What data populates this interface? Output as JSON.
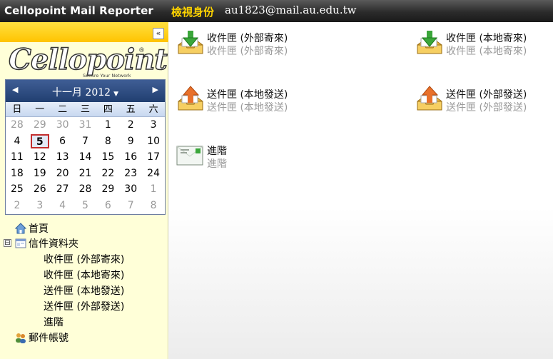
{
  "header": {
    "app_title": "Cellopoint Mail Reporter",
    "identity_label": "檢視身份",
    "identity_value": "au1823@mail.au.edu.tw"
  },
  "sidebar": {
    "collapse_glyph": "«",
    "logo": {
      "word": "Cellopoint",
      "tagline": "Secure Your Network",
      "reg": "®"
    }
  },
  "calendar": {
    "title": "十一月 2012",
    "prev": "◀",
    "next": "▶",
    "dropdown": "▼",
    "weekdays": [
      "日",
      "一",
      "二",
      "三",
      "四",
      "五",
      "六"
    ],
    "weeks": [
      [
        "28",
        "29",
        "30",
        "31",
        "1",
        "2",
        "3"
      ],
      [
        "4",
        "5",
        "6",
        "7",
        "8",
        "9",
        "10"
      ],
      [
        "11",
        "12",
        "13",
        "14",
        "15",
        "16",
        "17"
      ],
      [
        "18",
        "19",
        "20",
        "21",
        "22",
        "23",
        "24"
      ],
      [
        "25",
        "26",
        "27",
        "28",
        "29",
        "30",
        "1"
      ],
      [
        "2",
        "3",
        "4",
        "5",
        "6",
        "7",
        "8"
      ]
    ],
    "selected_day": "5"
  },
  "tree": {
    "home": "首頁",
    "folders": "信件資料夾",
    "children": [
      "收件匣 (外部寄來)",
      "收件匣 (本地寄來)",
      "送件匣 (本地發送)",
      "送件匣 (外部發送)",
      "進階"
    ],
    "accounts": "郵件帳號",
    "expander": "⊟"
  },
  "main": {
    "items": [
      {
        "label": "收件匣 (外部寄來)",
        "sub": "收件匣 (外部寄來)",
        "icon": "inbox-download-icon"
      },
      {
        "label": "收件匣 (本地寄來)",
        "sub": "收件匣 (本地寄來)",
        "icon": "inbox-download-icon"
      },
      {
        "label": "送件匣 (本地發送)",
        "sub": "送件匣 (本地發送)",
        "icon": "outbox-upload-icon"
      },
      {
        "label": "送件匣 (外部發送)",
        "sub": "送件匣 (外部發送)",
        "icon": "outbox-upload-icon"
      },
      {
        "label": "進階",
        "sub": "進階",
        "icon": "envelope-icon"
      }
    ]
  },
  "colors": {
    "header_bg": "#2b2b2b",
    "identity_label": "#ffd400",
    "sidebar_bg": "#ffffd8",
    "calendar_header": "#2b4a80",
    "today_border": "#c32d2d"
  }
}
